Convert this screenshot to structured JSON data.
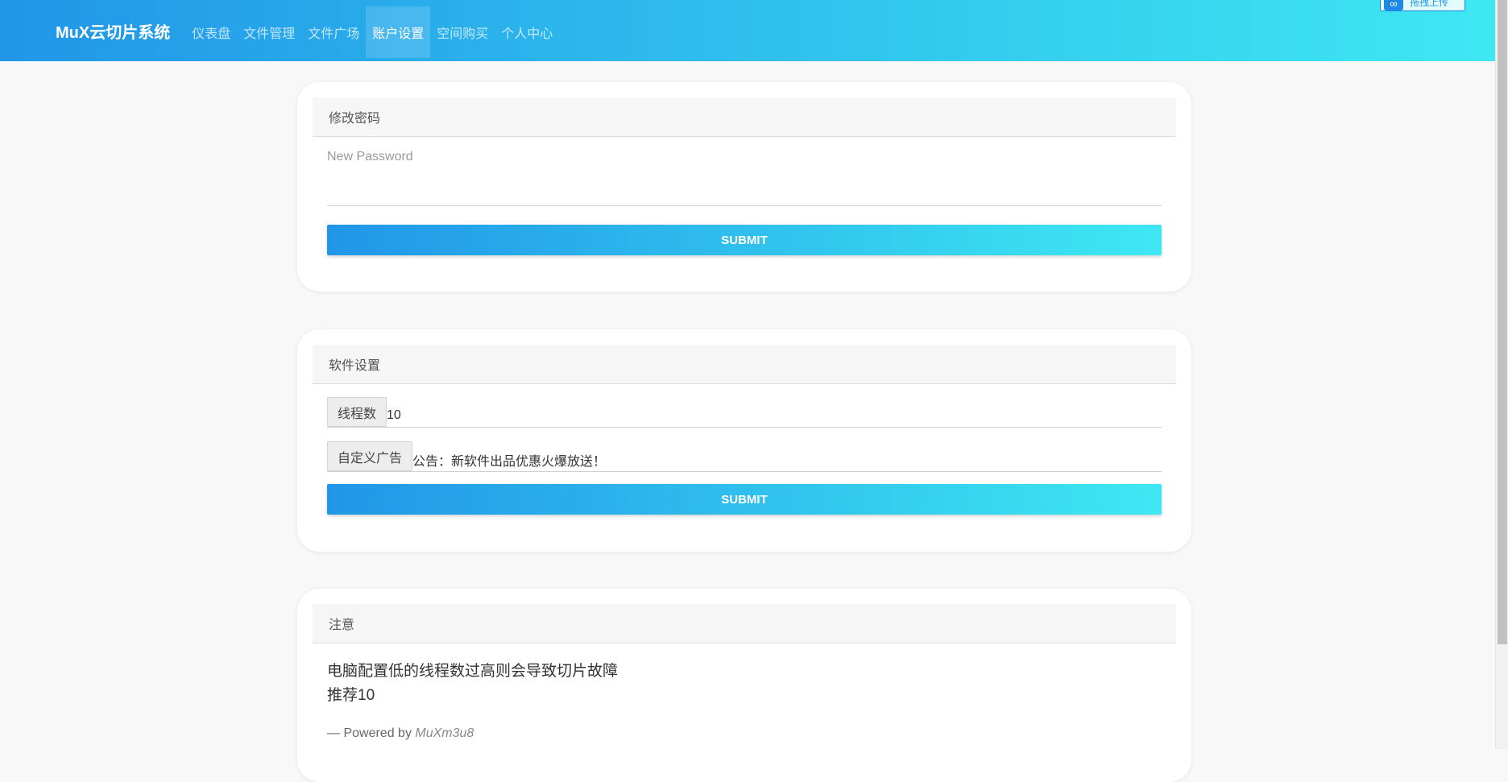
{
  "nav": {
    "brand": "MuX云切片系统",
    "items": [
      {
        "label": "仪表盘",
        "active": false
      },
      {
        "label": "文件管理",
        "active": false
      },
      {
        "label": "文件广场",
        "active": false
      },
      {
        "label": "账户设置",
        "active": true
      },
      {
        "label": "空间购买",
        "active": false
      },
      {
        "label": "个人中心",
        "active": false
      }
    ],
    "top_right_button": "拖拽上传"
  },
  "password_card": {
    "title": "修改密码",
    "field_label": "New Password",
    "value": "",
    "submit_label": "SUBMIT"
  },
  "software_card": {
    "title": "软件设置",
    "threads_label": "线程数",
    "threads_value": "10",
    "ad_label": "自定义广告",
    "ad_value": "公告：新软件出品优惠火爆放送！",
    "submit_label": "SUBMIT"
  },
  "notice_card": {
    "title": "注意",
    "line1": "电脑配置低的线程数过高则会导致切片故障",
    "line2": "推荐10",
    "powered_prefix": "— Powered by",
    "powered_author": "MuXm3u8"
  },
  "colors": {
    "gradient_start": "#2196e8",
    "gradient_end": "#3ee8f2"
  }
}
